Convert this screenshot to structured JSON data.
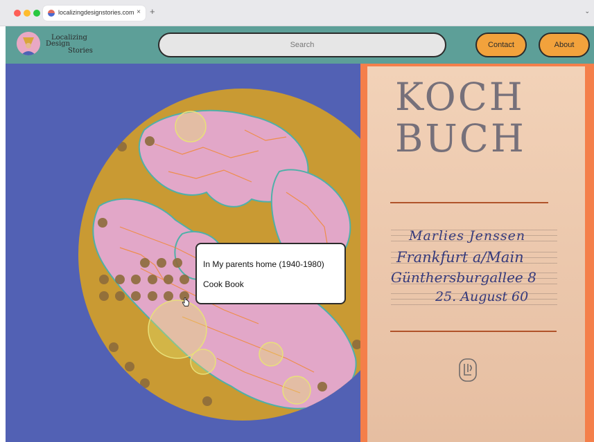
{
  "browser": {
    "tab_title": "localizingdesignstories.com",
    "tab_close": "×",
    "new_tab": "+",
    "menu_chevron": "⌄"
  },
  "header": {
    "logo": {
      "line1": "Localizing",
      "line2": "Design",
      "line3": "Stories"
    },
    "search_placeholder": "Search",
    "contact_label": "Contact",
    "about_label": "About"
  },
  "book": {
    "title_line1": "KOCH",
    "title_line2": "BUCH",
    "handwriting": [
      "Marlies Jenssen",
      "Frankfurt a/Main",
      "Günthersburgallee 8",
      "25. August 60"
    ]
  },
  "tooltip": {
    "title": "In My parents home (1940-1980)",
    "subtitle": "Cook Book"
  },
  "colors": {
    "header_bg": "#5d9f98",
    "main_bg": "#5261b4",
    "globe_land": "#e2a7c8",
    "globe_ocean": "#c99a33",
    "button_bg": "#f2a23c",
    "book_border": "#f47f4a"
  },
  "icons": {
    "favicon": "site-favicon-icon",
    "logo": "avatar-logo-icon",
    "cursor": "pointer-cursor-icon",
    "emblem": "publisher-emblem-icon"
  }
}
